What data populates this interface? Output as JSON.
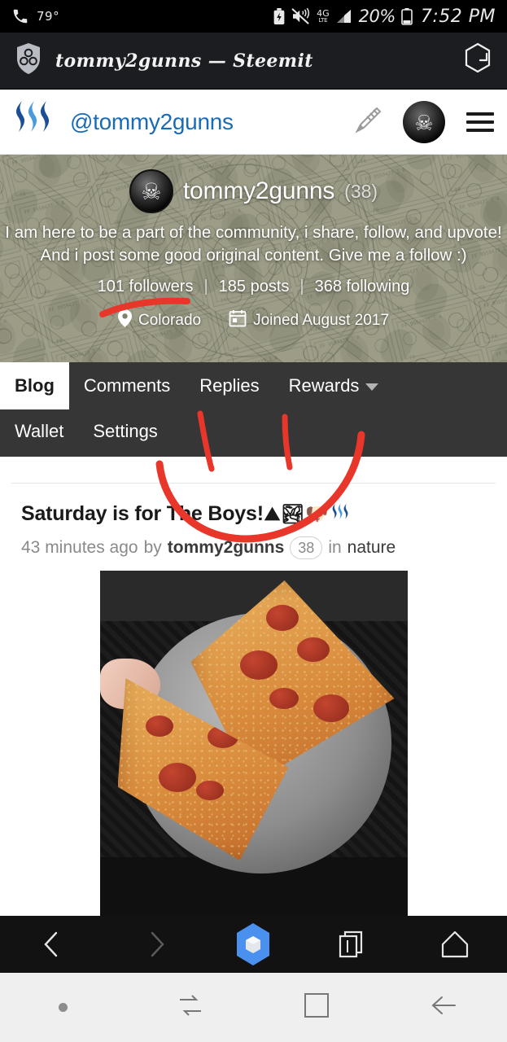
{
  "status_bar": {
    "phone_icon": "phone-icon",
    "temperature": "79°",
    "battery_saver_icon": "battery-saver-icon",
    "mute_icon": "volume-mute-icon",
    "network_type": "4G",
    "network_sub": "LTE",
    "signal_icon": "signal-bars-icon",
    "battery_percent": "20%",
    "battery_icon": "battery-icon",
    "time": "7:52 PM"
  },
  "browser": {
    "shields_icon": "brave-shields-icon",
    "page_title": "tommy2gunns — Steemit",
    "reload_icon": "reload-hexagon-icon",
    "bottom": {
      "back_icon": "back-chevron-icon",
      "forward_icon": "forward-chevron-icon",
      "brave_icon": "brave-cube-icon",
      "tabs_icon": "tabs-icon",
      "home_icon": "home-icon"
    }
  },
  "site_header": {
    "logo_icon": "steemit-logo-icon",
    "username": "@tommy2gunns",
    "pencil_icon": "pencil-compose-icon",
    "avatar_icon": "user-avatar-skull",
    "menu_icon": "hamburger-menu-icon"
  },
  "profile": {
    "avatar_icon": "profile-avatar-skull",
    "name": "tommy2gunns",
    "reputation": "(38)",
    "bio_line_1": "I am here to be a part of the community, i share, follow, and upvote!",
    "bio_line_2": "And i post some good original content. Give me a follow :)",
    "followers": "101 followers",
    "posts": "185 posts",
    "following": "368 following",
    "separator": "|",
    "location_icon": "location-pin-icon",
    "location": "Colorado",
    "calendar_icon": "calendar-icon",
    "joined": "Joined August 2017"
  },
  "tabs": {
    "row1": [
      {
        "label": "Blog",
        "active": true
      },
      {
        "label": "Comments",
        "active": false
      },
      {
        "label": "Replies",
        "active": false
      },
      {
        "label": "Rewards",
        "active": false,
        "caret": true
      }
    ],
    "row2": [
      {
        "label": "Wallet",
        "active": false
      },
      {
        "label": "Settings",
        "active": false
      }
    ]
  },
  "post": {
    "title": "Saturday is for The Boys!",
    "title_emojis": [
      "⛰",
      "🏞",
      "🐶"
    ],
    "title_steem_icon": "steem-logo-icon",
    "time_ago": "43 minutes ago",
    "by_label": "by",
    "author": "tommy2gunns",
    "author_reputation": "38",
    "in_label": "in",
    "category": "nature",
    "image_alt": "pepperoni-pizza-slices-photo"
  },
  "annotations": {
    "color": "#e8362a",
    "marks": [
      "underline-under-followers",
      "stroke-under-replies",
      "stroke-under-rewards",
      "curve-around-post-title"
    ]
  },
  "android_nav": {
    "dot_icon": "nav-dot-icon",
    "switch_icon": "app-switch-icon",
    "recents_icon": "recents-square-icon",
    "back_icon": "nav-back-arrow-icon"
  },
  "colors": {
    "brand_blue": "#1a6bb5",
    "tabbar_dark": "#363636",
    "browser_chrome": "#1b1d21",
    "annotation_red": "#e8362a",
    "brave_blue": "#4a90ee"
  }
}
